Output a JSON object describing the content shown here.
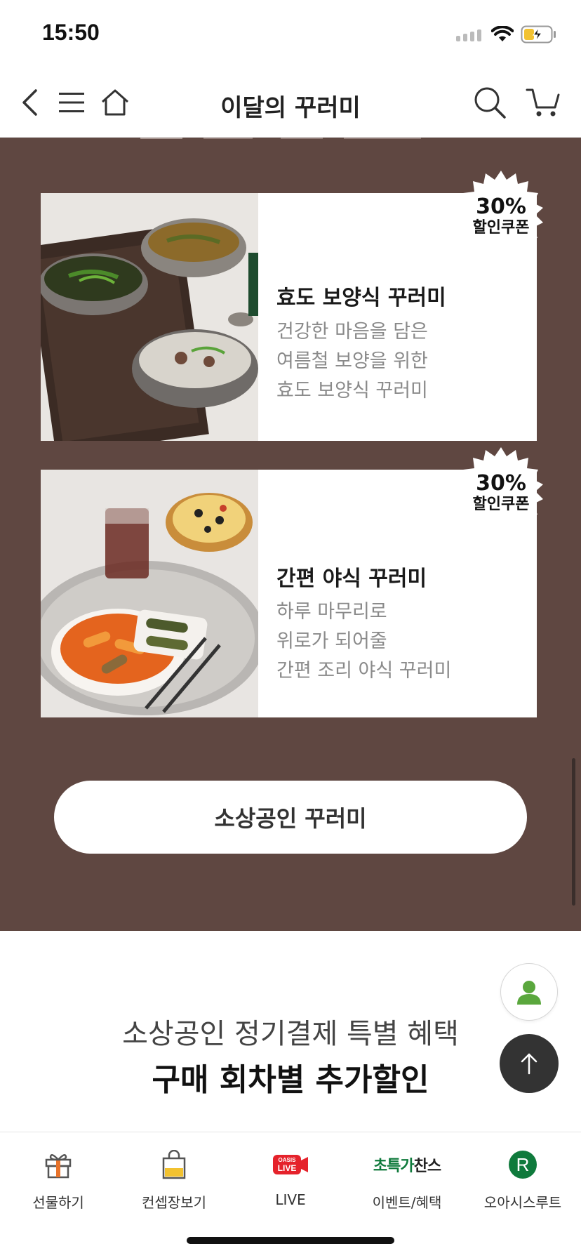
{
  "status_bar": {
    "time": "15:50"
  },
  "header": {
    "title": "이달의 꾸러미"
  },
  "promo": {
    "background": "#5f4741",
    "cards": [
      {
        "title": "효도 보양식 꾸러미",
        "desc": [
          "건강한 마음을 담은",
          "여름철 보양을 위한",
          "효도 보양식 꾸러미"
        ],
        "badge_pct": "30%",
        "badge_label": "할인쿠폰"
      },
      {
        "title": "간편 야식 꾸러미",
        "desc": [
          "하루 마무리로",
          "위로가 되어줄",
          "간편 조리 야식 꾸러미"
        ],
        "badge_pct": "30%",
        "badge_label": "할인쿠폰"
      }
    ],
    "button_label": "소상공인 꾸러미"
  },
  "benefit": {
    "subtitle": "소상공인 정기결제 특별 혜택",
    "title": "구매 회차별 추가할인"
  },
  "bottom_nav": {
    "items": [
      {
        "label": "선물하기",
        "icon": "gift-icon"
      },
      {
        "label": "컨셉장보기",
        "icon": "shopping-bag-icon"
      },
      {
        "label": "LIVE",
        "icon": "oasis-live-icon",
        "icon_text_top": "OASIS",
        "icon_text_bottom": "LIVE"
      },
      {
        "label": "이벤트/혜택",
        "icon": "chance-icon",
        "icon_text_a": "초특가",
        "icon_text_b": "찬스"
      },
      {
        "label": "오아시스루트",
        "icon": "route-r-icon",
        "icon_text": "R"
      }
    ]
  },
  "colors": {
    "brown": "#5f4741",
    "green_logo": "#0f7a3c",
    "live_red": "#e5222b",
    "gift_orange": "#e8732a",
    "bag_yellow": "#f2c230",
    "profile_green": "#5aa73d"
  }
}
